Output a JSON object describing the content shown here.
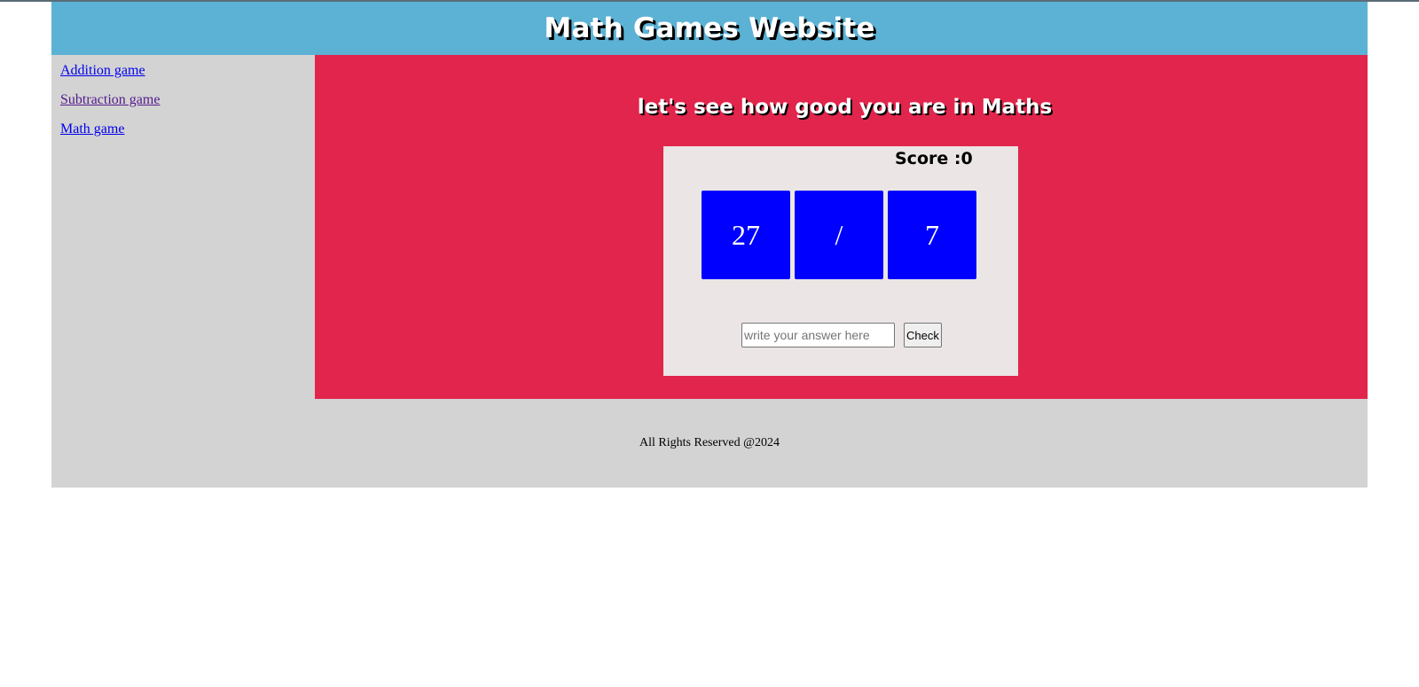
{
  "header": {
    "title": "Math Games Website"
  },
  "sidebar": {
    "items": [
      {
        "label": "Addition game"
      },
      {
        "label": "Subtraction game"
      },
      {
        "label": "Math game"
      }
    ]
  },
  "main": {
    "tagline": "let's see how good you are in Maths",
    "score_text": "Score :0",
    "tiles": {
      "left_operand": "27",
      "operator": "/",
      "right_operand": "7"
    },
    "answer": {
      "value": "",
      "placeholder": "write your answer here"
    },
    "check_label": "Check"
  },
  "footer": {
    "text": "All Rights Reserved @2024"
  },
  "colors": {
    "header_bg": "#5bb2d4",
    "main_bg": "#e2254c",
    "sidebar_bg": "#d3d3d3",
    "game_box_bg": "#ebe5e5",
    "tile_bg": "#0000ff",
    "link": "#0000ee",
    "visited_link": "#551a8b"
  }
}
